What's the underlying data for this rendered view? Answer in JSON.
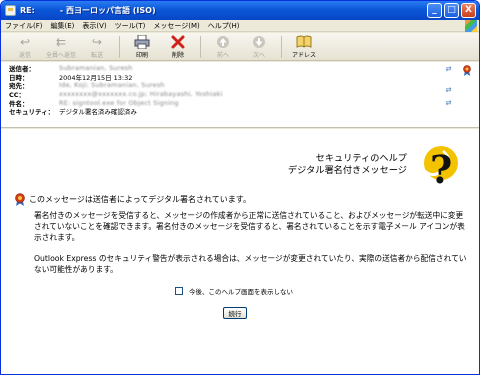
{
  "window": {
    "title": "RE:         - 西ヨーロッパ言語 (ISO)"
  },
  "titlebar_buttons": {
    "minimize": "_",
    "maximize": "□",
    "close": "X"
  },
  "menu": [
    "ファイル(F)",
    "編集(E)",
    "表示(V)",
    "ツール(T)",
    "メッセージ(M)",
    "ヘルプ(H)"
  ],
  "toolbar": [
    {
      "label": "返信",
      "icon": "reply-icon",
      "enabled": false
    },
    {
      "label": "全員へ返信",
      "icon": "reply-all-icon",
      "enabled": false
    },
    {
      "label": "転送",
      "icon": "forward-icon",
      "enabled": false
    },
    {
      "label": "印刷",
      "icon": "printer-icon",
      "enabled": true
    },
    {
      "label": "削除",
      "icon": "delete-icon",
      "enabled": true
    },
    {
      "label": "前へ",
      "icon": "previous-icon",
      "enabled": false
    },
    {
      "label": "次へ",
      "icon": "next-icon",
      "enabled": false
    },
    {
      "label": "アドレス",
      "icon": "address-book-icon",
      "enabled": true
    }
  ],
  "header": {
    "from_label": "送信者：",
    "from_value": "Subramanian, Suresh",
    "date_label": "日時：",
    "date_value": "2004年12月15日 13:32",
    "to_label": "宛先：",
    "to_value": "Ide, Koji; Subramanian, Suresh",
    "cc_label": "CC：",
    "cc_value": "xxxxxxxx@xxxxxxx.co.jp; Hirabayashi, Yoshiaki",
    "subject_label": "件名：",
    "subject_value": "RE: signtool.exe for Object Signing",
    "security_label": "セキュリティ：",
    "security_value": "デジタル署名済み確認済み"
  },
  "help": {
    "title_line1": "セキュリティのヘルプ",
    "title_line2": "デジタル署名付きメッセージ",
    "message_line": "このメッセージは送信者によってデジタル署名されています。",
    "para1": "署名付きのメッセージを受信すると、メッセージの作成者から正常に送信されていること、およびメッセージが転送中に変更されていないことを確認できます。署名付きのメッセージを受信すると、署名されていることを示す電子メール アイコンが表示されます。",
    "para2": "Outlook Express のセキュリティ警告が表示される場合は、メッセージが変更されていたり、実際の送信者から配信されていない可能性があります。",
    "checkbox_label": "今後、このヘルプ画面を表示しない",
    "checkbox_checked": false,
    "continue_button": "続行"
  },
  "colors": {
    "titlebar": "#0a58d8",
    "seal": "#cc3a10",
    "question_mark_bg": "#f3c300"
  }
}
